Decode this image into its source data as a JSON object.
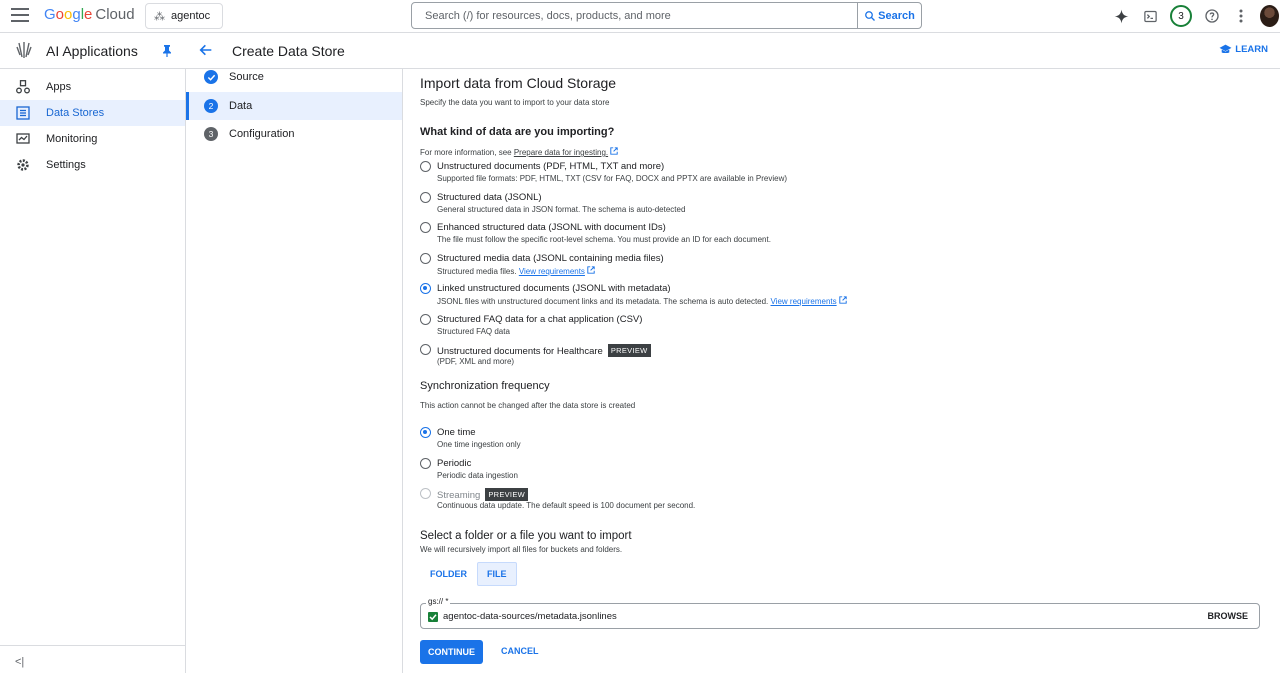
{
  "topbar": {
    "logo_google": "Google",
    "logo_cloud": "Cloud",
    "project": "agentoc",
    "search_placeholder": "Search (/) for resources, docs, products, and more",
    "search_button": "Search",
    "notifications_count": "3"
  },
  "subbar": {
    "app_title": "AI Applications",
    "page_title": "Create Data Store",
    "learn": "LEARN"
  },
  "sidebar": {
    "items": [
      {
        "label": "Apps",
        "icon": "apps-icon"
      },
      {
        "label": "Data Stores",
        "icon": "data-stores-icon",
        "active": true
      },
      {
        "label": "Monitoring",
        "icon": "monitoring-icon"
      },
      {
        "label": "Settings",
        "icon": "settings-icon"
      }
    ],
    "collapse": "<|"
  },
  "stepper": {
    "steps": [
      {
        "num": "",
        "label": "Source",
        "state": "done"
      },
      {
        "num": "2",
        "label": "Data",
        "state": "active"
      },
      {
        "num": "3",
        "label": "Configuration",
        "state": "pending"
      }
    ]
  },
  "main": {
    "title": "Import data from Cloud Storage",
    "subtitle": "Specify the data you want to import to your data store",
    "kind_heading": "What kind of data are you importing?",
    "more_info_prefix": "For more information, see",
    "more_info_link": "Prepare data for ingesting.",
    "data_kinds": [
      {
        "label": "Unstructured documents (PDF, HTML, TXT and more)",
        "desc": "Supported file formats: PDF, HTML, TXT (CSV for FAQ, DOCX and PPTX are available in Preview)",
        "checked": false
      },
      {
        "label": "Structured data (JSONL)",
        "desc": "General structured data in JSON format. The schema is auto-detected",
        "checked": false
      },
      {
        "label": "Enhanced structured data (JSONL with document IDs)",
        "desc": "The file must follow the specific root-level schema. You must provide an ID for each document.",
        "checked": false
      },
      {
        "label": "Structured media data (JSONL containing media files)",
        "desc": "Structured media files.",
        "link": "View requirements",
        "checked": false
      },
      {
        "label": "Linked unstructured documents (JSONL with metadata)",
        "desc": "JSONL files with unstructured document links and its metadata. The schema is auto detected.",
        "link": "View requirements",
        "checked": true
      },
      {
        "label": "Structured FAQ data for a chat application (CSV)",
        "desc": "Structured FAQ data",
        "checked": false
      },
      {
        "label": "Unstructured documents for Healthcare",
        "desc": "(PDF, XML and more)",
        "pill": "PREVIEW",
        "checked": false
      }
    ],
    "sync_heading": "Synchronization frequency",
    "sync_note": "This action cannot be changed after the data store is created",
    "sync_options": [
      {
        "label": "One time",
        "desc": "One time ingestion only",
        "checked": true
      },
      {
        "label": "Periodic",
        "desc": "Periodic data ingestion",
        "checked": false
      },
      {
        "label": "Streaming",
        "desc": "Continuous data update. The default speed is 100 document per second.",
        "pill": "PREVIEW",
        "disabled": true
      }
    ],
    "select_heading": "Select a folder or a file you want to import",
    "select_note": "We will recursively import all files for buckets and folders.",
    "tabs": [
      "FOLDER",
      "FILE"
    ],
    "field_label": "gs:// *",
    "field_value": "agentoc-data-sources/metadata.jsonlines",
    "browse": "BROWSE",
    "continue": "CONTINUE",
    "cancel": "CANCEL"
  }
}
